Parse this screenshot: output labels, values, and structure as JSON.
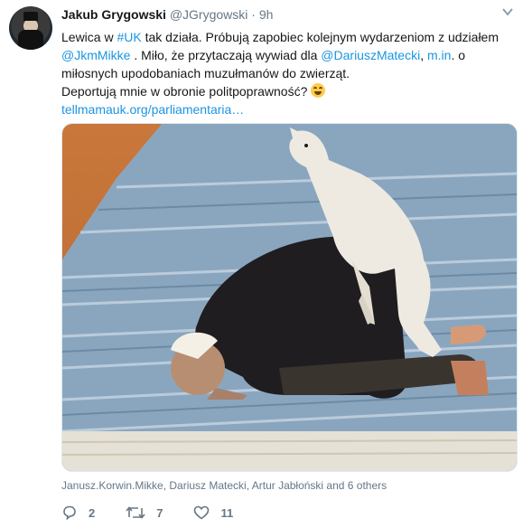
{
  "tweet": {
    "author_name": "Jakub Grygowski",
    "author_handle": "@JGrygowski",
    "separator": "·",
    "time": "9h",
    "text_parts": {
      "p1": "Lewica w ",
      "hashtag": "#UK",
      "p2": " tak działa. Próbują zapobiec kolejnym wydarzeniom z udziałem ",
      "mention1": "@JkmMikke",
      "p3": " . Miło, że przytaczają wywiad dla ",
      "mention2": "@DariuszMatecki",
      "p4": ", ",
      "link1": "m.in",
      "p5": ". o miłosnych upodobaniach muzułmanów do zwierząt.",
      "line2": "Deportują mnie w obronie politpoprawność? ",
      "url": "tellmamauk.org/parliamentaria…"
    },
    "emoji": "face-with-tears-of-joy",
    "media_alt": "photo",
    "tagged": "Janusz.Korwin.Mikke, Dariusz Matecki, Artur Jabłoński and 6 others",
    "reply_count": "2",
    "retweet_count": "7",
    "like_count": "11"
  },
  "colors": {
    "link": "#1b95e0",
    "muted": "#657786",
    "text": "#14171a"
  }
}
